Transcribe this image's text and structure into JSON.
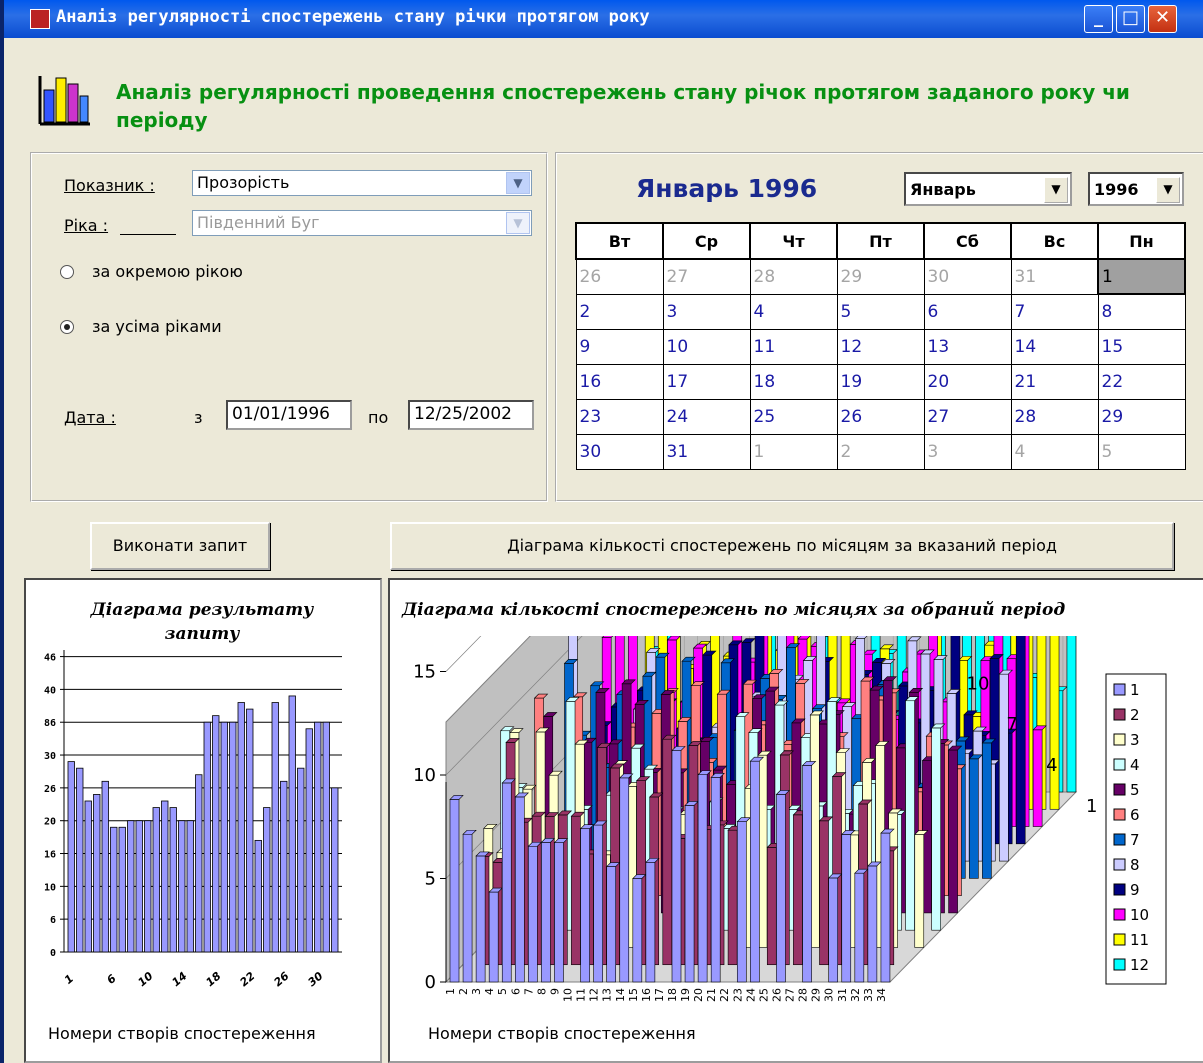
{
  "window": {
    "title": "Аналіз регулярності спостережень стану річки протягом року"
  },
  "header": {
    "text": "Аналіз регулярності проведення спостережень стану річок протягом заданого року чи періоду"
  },
  "filters": {
    "indicator_label": "Показник :",
    "indicator_value": "Прозорість",
    "river_label": "Ріка :",
    "river_value": "Південний Буг",
    "radio_single": "за окремою рікою",
    "radio_all": "за усіма ріками",
    "radio_selected": "all",
    "date_label": "Дата :",
    "date_from_label": "з",
    "date_from": "01/01/1996",
    "date_to_label": "по",
    "date_to": "12/25/2002"
  },
  "calendar": {
    "title": "Январь 1996",
    "month_value": "Январь",
    "year_value": "1996",
    "weekdays": [
      "Вт",
      "Ср",
      "Чт",
      "Пт",
      "Сб",
      "Вс",
      "Пн"
    ],
    "rows": [
      [
        "26",
        "27",
        "28",
        "29",
        "30",
        "31",
        "1"
      ],
      [
        "2",
        "3",
        "4",
        "5",
        "6",
        "7",
        "8"
      ],
      [
        "9",
        "10",
        "11",
        "12",
        "13",
        "14",
        "15"
      ],
      [
        "16",
        "17",
        "18",
        "19",
        "20",
        "21",
        "22"
      ],
      [
        "23",
        "24",
        "25",
        "26",
        "27",
        "28",
        "29"
      ],
      [
        "30",
        "31",
        "1",
        "2",
        "3",
        "4",
        "5"
      ]
    ],
    "selected_day": "1"
  },
  "buttons": {
    "run_query": "Виконати запит",
    "monthly_chart": "Діаграма кількості спостережень по місяцям за вказаний період"
  },
  "chart_left": {
    "title": "Діаграма результату запиту",
    "xlabel": "Номери створів спостереження",
    "chart_data": {
      "type": "bar",
      "title": "Діаграма результату запиту",
      "xlabel": "Номери створів спостереження",
      "ylim": [
        0,
        46
      ],
      "yticks": [
        0,
        5,
        10,
        15,
        20,
        25,
        30,
        35,
        40,
        45
      ],
      "ytick_labels": [
        "0",
        "6",
        "10",
        "16",
        "20",
        "26",
        "30",
        "86",
        "40",
        "46"
      ],
      "xtick_labels": [
        "1",
        "6",
        "10",
        "14",
        "18",
        "22",
        "26",
        "30"
      ],
      "values": [
        29,
        28,
        23,
        24,
        26,
        19,
        19,
        20,
        20,
        20,
        22,
        23,
        22,
        20,
        20,
        27,
        35,
        36,
        35,
        35,
        38,
        37,
        17,
        22,
        38,
        26,
        39,
        28,
        34,
        35,
        35,
        25
      ]
    }
  },
  "chart_right": {
    "title": "Діаграма кількості спостережень по місяцях за обраний період",
    "xlabel": "Номери створів спостереження",
    "chart_data": {
      "type": "bar",
      "title": "Діаграма кількості спостережень по місяцях за обраний період",
      "xlabel": "Номери створів спостереження",
      "zlim": [
        0,
        15
      ],
      "zticks": [
        "0",
        "5",
        "10",
        "15"
      ],
      "depth_ticks": [
        "1",
        "4",
        "7",
        "10"
      ],
      "x_categories": [
        "1",
        "2",
        "3",
        "4",
        "5",
        "6",
        "7",
        "8",
        "9",
        "10",
        "11",
        "12",
        "13",
        "14",
        "15",
        "16",
        "17",
        "18",
        "19",
        "20",
        "21",
        "22",
        "23",
        "24",
        "25",
        "26",
        "27",
        "28",
        "29",
        "30",
        "31",
        "32",
        "33",
        "34"
      ],
      "series": [
        {
          "name": "1",
          "color": "#9999ff"
        },
        {
          "name": "2",
          "color": "#993366"
        },
        {
          "name": "3",
          "color": "#ffffcc"
        },
        {
          "name": "4",
          "color": "#ccffff"
        },
        {
          "name": "5",
          "color": "#660066"
        },
        {
          "name": "6",
          "color": "#ff8080"
        },
        {
          "name": "7",
          "color": "#0066cc"
        },
        {
          "name": "8",
          "color": "#ccccff"
        },
        {
          "name": "9",
          "color": "#000080"
        },
        {
          "name": "10",
          "color": "#ff00ff"
        },
        {
          "name": "11",
          "color": "#ffff00"
        },
        {
          "name": "12",
          "color": "#00ffff"
        }
      ]
    }
  }
}
